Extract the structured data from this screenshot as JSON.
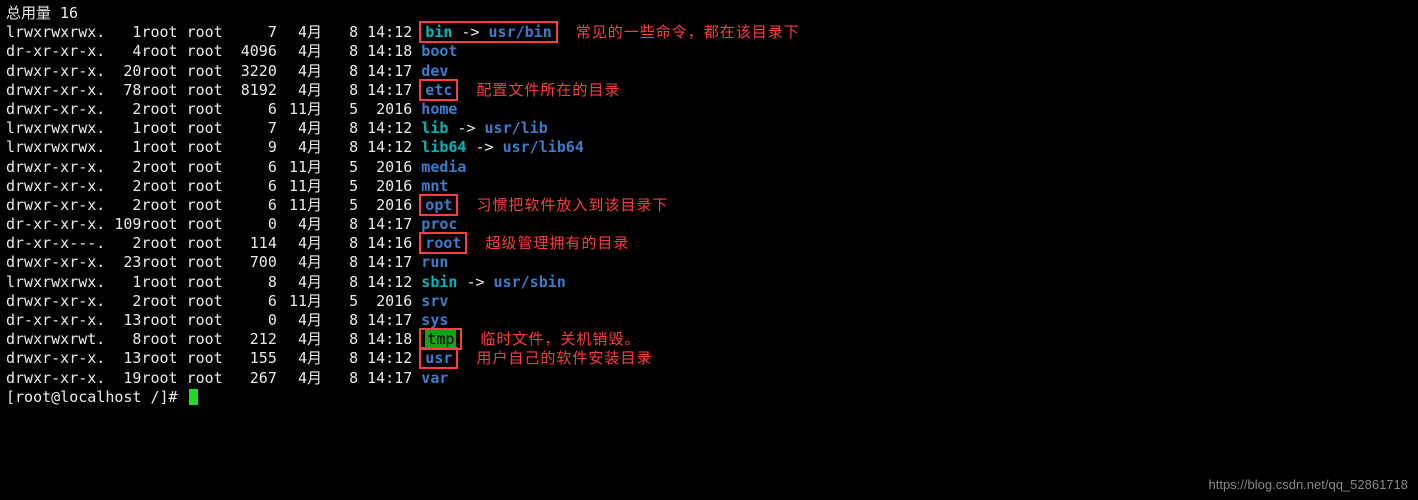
{
  "header": "总用量 16",
  "prompt": "[root@localhost /]# ",
  "watermark": "https://blog.csdn.net/qq_52861718",
  "annotations": {
    "bin": "常见的一些命令，都在该目录下",
    "etc": "配置文件所在的目录",
    "opt": "习惯把软件放入到该目录下",
    "root": "超级管理拥有的目录",
    "tmp": "临时文件，关机销毁。",
    "usr": "用户自己的软件安装目录"
  },
  "rows": [
    {
      "perms": "lrwxrwxrwx.",
      "links": "1",
      "owner": "root",
      "group": "root",
      "size": "7",
      "month": "4月",
      "day": "8",
      "time": "14:12",
      "name": "bin",
      "style": "link",
      "target": "usr/bin",
      "boxed": true,
      "annot": "bin"
    },
    {
      "perms": "dr-xr-xr-x.",
      "links": "4",
      "owner": "root",
      "group": "root",
      "size": "4096",
      "month": "4月",
      "day": "8",
      "time": "14:18",
      "name": "boot",
      "style": "dir"
    },
    {
      "perms": "drwxr-xr-x.",
      "links": "20",
      "owner": "root",
      "group": "root",
      "size": "3220",
      "month": "4月",
      "day": "8",
      "time": "14:17",
      "name": "dev",
      "style": "dir"
    },
    {
      "perms": "drwxr-xr-x.",
      "links": "78",
      "owner": "root",
      "group": "root",
      "size": "8192",
      "month": "4月",
      "day": "8",
      "time": "14:17",
      "name": "etc",
      "style": "dir",
      "boxed": true,
      "annot": "etc"
    },
    {
      "perms": "drwxr-xr-x.",
      "links": "2",
      "owner": "root",
      "group": "root",
      "size": "6",
      "month": "11月",
      "day": "5",
      "time": "2016",
      "name": "home",
      "style": "dir"
    },
    {
      "perms": "lrwxrwxrwx.",
      "links": "1",
      "owner": "root",
      "group": "root",
      "size": "7",
      "month": "4月",
      "day": "8",
      "time": "14:12",
      "name": "lib",
      "style": "link",
      "target": "usr/lib"
    },
    {
      "perms": "lrwxrwxrwx.",
      "links": "1",
      "owner": "root",
      "group": "root",
      "size": "9",
      "month": "4月",
      "day": "8",
      "time": "14:12",
      "name": "lib64",
      "style": "link",
      "target": "usr/lib64"
    },
    {
      "perms": "drwxr-xr-x.",
      "links": "2",
      "owner": "root",
      "group": "root",
      "size": "6",
      "month": "11月",
      "day": "5",
      "time": "2016",
      "name": "media",
      "style": "dir"
    },
    {
      "perms": "drwxr-xr-x.",
      "links": "2",
      "owner": "root",
      "group": "root",
      "size": "6",
      "month": "11月",
      "day": "5",
      "time": "2016",
      "name": "mnt",
      "style": "dir"
    },
    {
      "perms": "drwxr-xr-x.",
      "links": "2",
      "owner": "root",
      "group": "root",
      "size": "6",
      "month": "11月",
      "day": "5",
      "time": "2016",
      "name": "opt",
      "style": "dir",
      "boxed": true,
      "annot": "opt"
    },
    {
      "perms": "dr-xr-xr-x.",
      "links": "109",
      "owner": "root",
      "group": "root",
      "size": "0",
      "month": "4月",
      "day": "8",
      "time": "14:17",
      "name": "proc",
      "style": "dir"
    },
    {
      "perms": "dr-xr-x---.",
      "links": "2",
      "owner": "root",
      "group": "root",
      "size": "114",
      "month": "4月",
      "day": "8",
      "time": "14:16",
      "name": "root",
      "style": "dir",
      "boxed": true,
      "annot": "root"
    },
    {
      "perms": "drwxr-xr-x.",
      "links": "23",
      "owner": "root",
      "group": "root",
      "size": "700",
      "month": "4月",
      "day": "8",
      "time": "14:17",
      "name": "run",
      "style": "dir"
    },
    {
      "perms": "lrwxrwxrwx.",
      "links": "1",
      "owner": "root",
      "group": "root",
      "size": "8",
      "month": "4月",
      "day": "8",
      "time": "14:12",
      "name": "sbin",
      "style": "link",
      "target": "usr/sbin"
    },
    {
      "perms": "drwxr-xr-x.",
      "links": "2",
      "owner": "root",
      "group": "root",
      "size": "6",
      "month": "11月",
      "day": "5",
      "time": "2016",
      "name": "srv",
      "style": "dir"
    },
    {
      "perms": "dr-xr-xr-x.",
      "links": "13",
      "owner": "root",
      "group": "root",
      "size": "0",
      "month": "4月",
      "day": "8",
      "time": "14:17",
      "name": "sys",
      "style": "dir"
    },
    {
      "perms": "drwxrwxrwt.",
      "links": "8",
      "owner": "root",
      "group": "root",
      "size": "212",
      "month": "4月",
      "day": "8",
      "time": "14:18",
      "name": "tmp",
      "style": "tmp",
      "boxed": true,
      "annot": "tmp"
    },
    {
      "perms": "drwxr-xr-x.",
      "links": "13",
      "owner": "root",
      "group": "root",
      "size": "155",
      "month": "4月",
      "day": "8",
      "time": "14:12",
      "name": "usr",
      "style": "dir",
      "boxed": true,
      "annot": "usr"
    },
    {
      "perms": "drwxr-xr-x.",
      "links": "19",
      "owner": "root",
      "group": "root",
      "size": "267",
      "month": "4月",
      "day": "8",
      "time": "14:17",
      "name": "var",
      "style": "dir"
    }
  ]
}
